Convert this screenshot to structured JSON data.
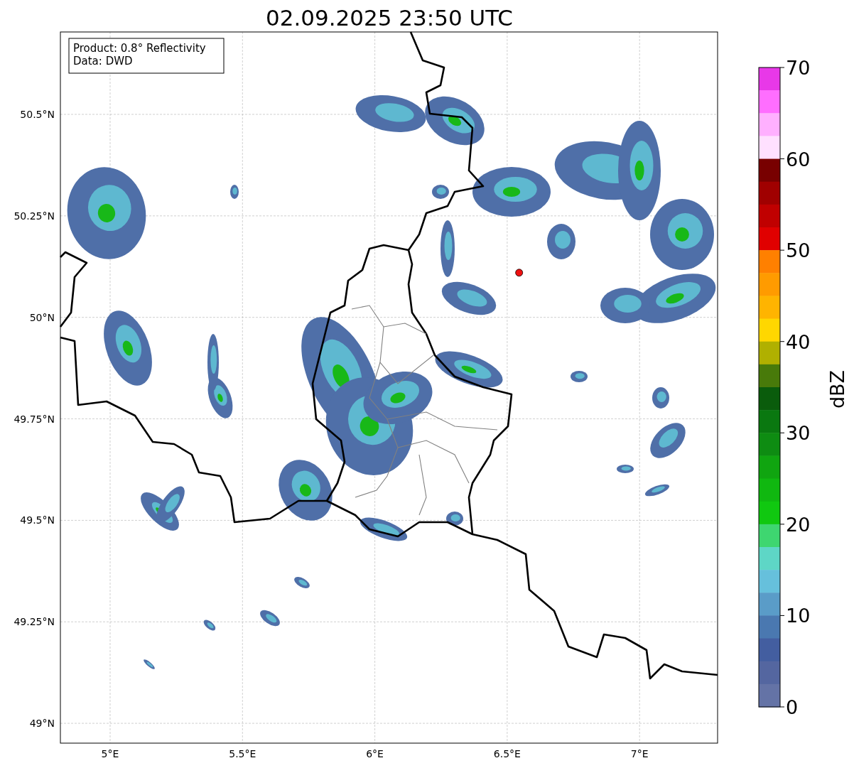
{
  "title": "02.09.2025 23:50 UTC",
  "info_box": {
    "lines": [
      "Product: 0.8° Reflectivity",
      "Data: DWD"
    ]
  },
  "map": {
    "lat_labels": [
      "50.5°N",
      "50.25°N",
      "50°N",
      "49.75°N",
      "49.5°N",
      "49.25°N",
      "49°N"
    ],
    "lon_labels": [
      "5°E",
      "5.5°E",
      "6°E",
      "6.5°E",
      "7°E"
    ]
  },
  "colorbar": {
    "label": "dBZ",
    "ticks": [
      "70",
      "60",
      "50",
      "40",
      "30",
      "20",
      "10",
      "0"
    ],
    "bins": [
      {
        "color": "#e838e8"
      },
      {
        "color": "#ff6eff"
      },
      {
        "color": "#ffb0ff"
      },
      {
        "color": "#ffe0ff"
      },
      {
        "color": "#780000"
      },
      {
        "color": "#a00000"
      },
      {
        "color": "#c00000"
      },
      {
        "color": "#e00000"
      },
      {
        "color": "#ff8000"
      },
      {
        "color": "#ff9b00"
      },
      {
        "color": "#ffb400"
      },
      {
        "color": "#ffd700"
      },
      {
        "color": "#b0b000"
      },
      {
        "color": "#487a0a"
      },
      {
        "color": "#0a5c0c"
      },
      {
        "color": "#0a7810"
      },
      {
        "color": "#0e8c12"
      },
      {
        "color": "#10a510"
      },
      {
        "color": "#10b810"
      },
      {
        "color": "#10c810"
      },
      {
        "color": "#3ed670"
      },
      {
        "color": "#5ed6c6"
      },
      {
        "color": "#66c0dc"
      },
      {
        "color": "#5a9cc8"
      },
      {
        "color": "#4a78b0"
      },
      {
        "color": "#435ea0"
      },
      {
        "color": "#5466a0"
      },
      {
        "color": "#6473a6"
      }
    ]
  }
}
